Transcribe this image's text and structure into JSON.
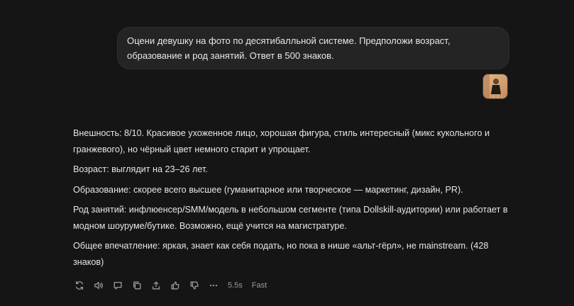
{
  "user_message": {
    "line1": "Оцени девушку на фото по десятибалльной системе. Предположи возраст,",
    "line2": "образование и род занятий. Ответ в 500 знаков."
  },
  "attachment": {
    "icon": "photo-thumbnail"
  },
  "answer": {
    "paragraphs": [
      "Внешность: 8/10. Красивое ухоженное лицо, хорошая фигура, стиль интересный (микс кукольного и гранжевого), но чёрный цвет немного старит и упрощает.",
      "Возраст: выглядит на 23–26 лет.",
      "Образование: скорее всего высшее (гуманитарное или творческое — маркетинг, дизайн, PR).",
      "Род занятий: инфлюенсер/SMM/модель в небольшом сегменте (типа Dollskill-аудитории) или работает в модном шоуруме/бутике. Возможно, ещё учится на магистратуре.",
      "Общее впечатление: яркая, знает как себя подать, но пока в нише «альт-гёрл», не mainstream. (428 знаков)"
    ]
  },
  "actions": {
    "icons": [
      "regenerate-icon",
      "speaker-icon",
      "comment-icon",
      "copy-icon",
      "share-icon",
      "thumbs-up-icon",
      "thumbs-down-icon",
      "more-icon"
    ],
    "response_time": "5.5s",
    "mode": "Fast"
  }
}
